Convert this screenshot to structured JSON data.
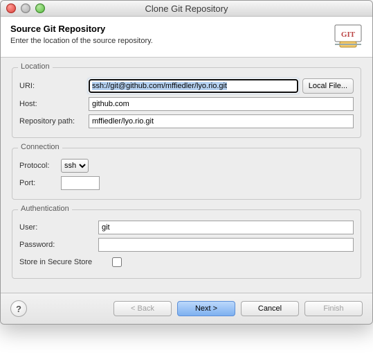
{
  "window": {
    "title": "Clone Git Repository"
  },
  "banner": {
    "heading": "Source Git Repository",
    "subheading": "Enter the location of the source repository.",
    "icon_label": "GIT"
  },
  "location": {
    "legend": "Location",
    "uri_label": "URI:",
    "uri_value": "ssh://git@github.com/mffiedler/lyo.rio.git",
    "local_file_label": "Local File...",
    "host_label": "Host:",
    "host_value": "github.com",
    "repo_path_label": "Repository path:",
    "repo_path_value": "mffiedler/lyo.rio.git"
  },
  "connection": {
    "legend": "Connection",
    "protocol_label": "Protocol:",
    "protocol_value": "ssh",
    "port_label": "Port:",
    "port_value": ""
  },
  "authentication": {
    "legend": "Authentication",
    "user_label": "User:",
    "user_value": "git",
    "password_label": "Password:",
    "password_value": "",
    "store_label": "Store in Secure Store",
    "store_checked": false
  },
  "footer": {
    "back_label": "< Back",
    "next_label": "Next >",
    "cancel_label": "Cancel",
    "finish_label": "Finish"
  }
}
